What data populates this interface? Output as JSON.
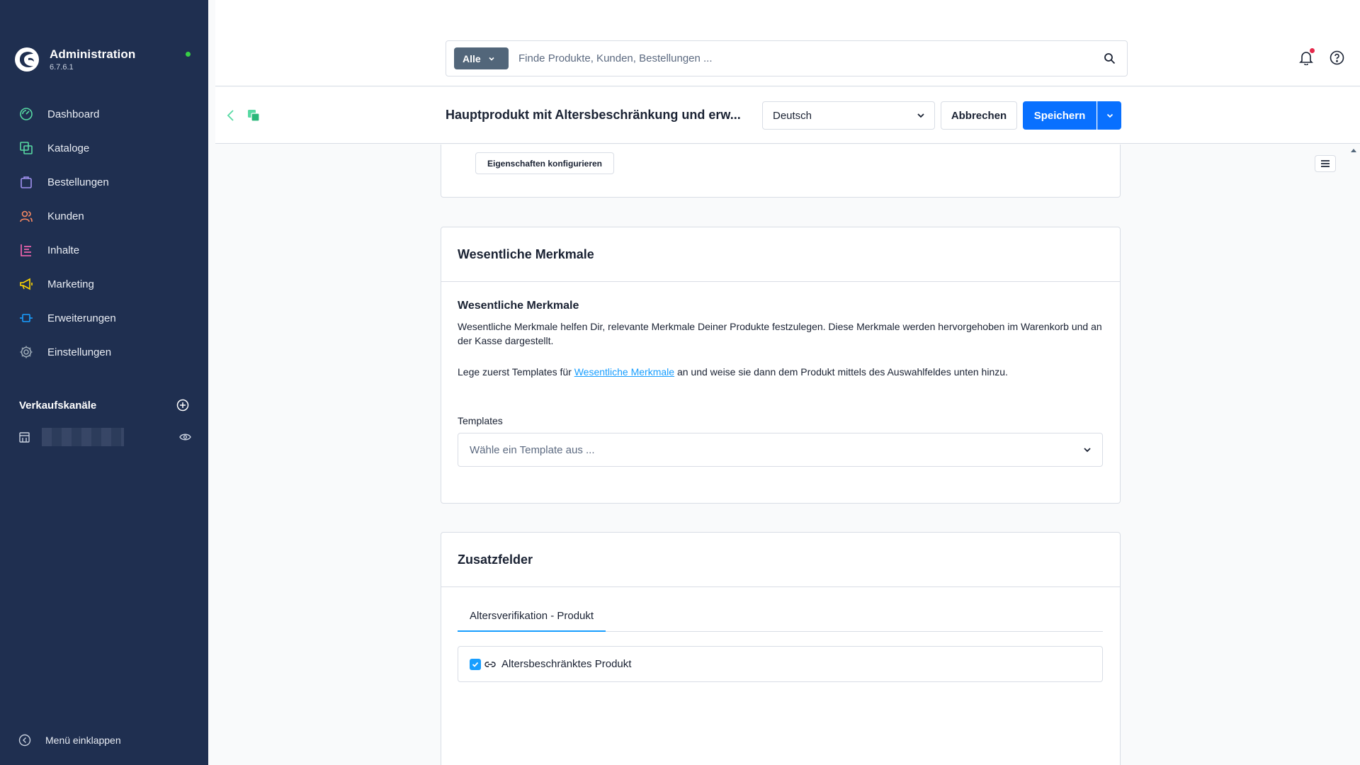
{
  "brand": {
    "title": "Administration",
    "version": "6.7.6.1",
    "status_color": "#37d046"
  },
  "sidebar": {
    "items": [
      {
        "label": "Dashboard",
        "icon": "dashboard-icon",
        "color": "#57d9a3"
      },
      {
        "label": "Kataloge",
        "icon": "catalog-icon",
        "color": "#57d9a3"
      },
      {
        "label": "Bestellungen",
        "icon": "orders-icon",
        "color": "#a092f0"
      },
      {
        "label": "Kunden",
        "icon": "customers-icon",
        "color": "#f88962"
      },
      {
        "label": "Inhalte",
        "icon": "content-icon",
        "color": "#ff68b4"
      },
      {
        "label": "Marketing",
        "icon": "marketing-icon",
        "color": "#ffd700"
      },
      {
        "label": "Erweiterungen",
        "icon": "extensions-icon",
        "color": "#189eff"
      },
      {
        "label": "Einstellungen",
        "icon": "settings-icon",
        "color": "#9aa8b5"
      }
    ],
    "channels_title": "Verkaufskanäle",
    "collapse_label": "Menü einklappen"
  },
  "search": {
    "type_label": "Alle",
    "placeholder": "Finde Produkte, Kunden, Bestellungen ..."
  },
  "smartbar": {
    "title": "Hauptprodukt mit Altersbeschränkung und erw...",
    "language": "Deutsch",
    "cancel_label": "Abbrechen",
    "save_label": "Speichern"
  },
  "properties": {
    "configure_label": "Eigenschaften konfigurieren"
  },
  "essential": {
    "card_title": "Wesentliche Merkmale",
    "sub_title": "Wesentliche Merkmale",
    "description": "Wesentliche Merkmale helfen Dir, relevante Merkmale Deiner Produkte festzulegen. Diese Merkmale werden hervorgehoben im Warenkorb und an der Kasse dargestellt.",
    "hint_before": "Lege zuerst Templates für ",
    "hint_link": "Wesentliche Merkmale",
    "hint_after": " an und weise sie dann dem Produkt mittels des Auswahlfeldes unten hinzu.",
    "templates_label": "Templates",
    "templates_placeholder": "Wähle ein Template aus ..."
  },
  "custom_fields": {
    "card_title": "Zusatzfelder",
    "tab_label": "Altersverifikation - Produkt",
    "checkbox_label": "Altersbeschränktes Produkt",
    "checked": true
  },
  "colors": {
    "primary": "#0870ff",
    "link": "#189eff",
    "sidebar_bg": "#1f2f50"
  }
}
